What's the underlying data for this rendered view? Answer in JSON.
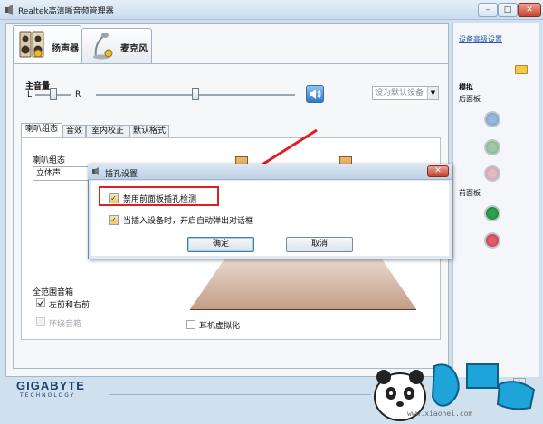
{
  "window": {
    "title": "Realtek高清晰音频管理器",
    "minimize": "–",
    "maximize": "□",
    "close": "✕"
  },
  "tabs": [
    {
      "label": "扬声器",
      "icon": "speaker-icon"
    },
    {
      "label": "麦克风",
      "icon": "microphone-icon"
    }
  ],
  "main_volume": {
    "label": "主音量",
    "left": "L",
    "right": "R",
    "default_device_button": "设为默认设备",
    "dropdown_arrow": "▼"
  },
  "sub_tabs": [
    "喇叭组态",
    "音效",
    "室内校正",
    "默认格式"
  ],
  "speaker_config": {
    "label": "喇叭组态",
    "selected": "立体声"
  },
  "full_range": {
    "label": "全范围音箱",
    "front_lr": "左前和右前",
    "surround": "环绕音箱"
  },
  "headphone_virtualization": "耳机虚拟化",
  "footer": {
    "logo": "GIGABYTE",
    "logo_sub": "TECHNOLOGY",
    "info": "i"
  },
  "right_panel": {
    "advanced_link": "设备高级设置",
    "analog": "模拟",
    "back_panel": "后面板",
    "front_panel": "前面板"
  },
  "dialog": {
    "title": "插孔设置",
    "close": "✕",
    "option1": "禁用前面板插孔检测",
    "option2": "当插入设备时，开启自动弹出对话框",
    "check": "✓",
    "ok": "确定",
    "cancel": "取消"
  },
  "watermark": {
    "url": "www.xiaohei.com"
  },
  "colors": {
    "accent_blue": "#2f78c8",
    "highlight_red": "#e02020",
    "jack_green_front": "#13702d",
    "jack_red_front": "#a92f3f"
  }
}
